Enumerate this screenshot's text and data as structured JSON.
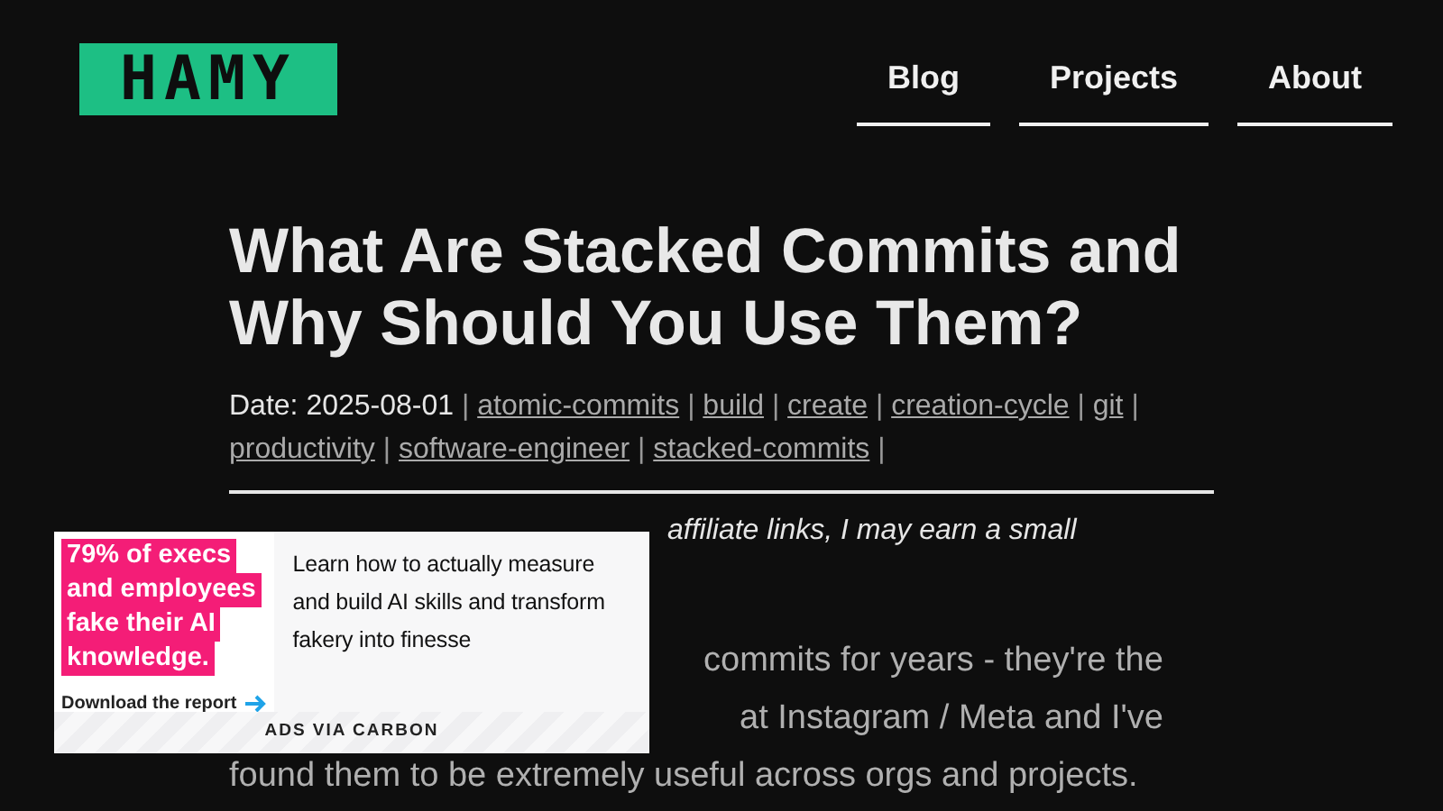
{
  "logo": {
    "text": "HAMY"
  },
  "nav": [
    {
      "label": "Blog"
    },
    {
      "label": "Projects"
    },
    {
      "label": "About"
    }
  ],
  "article": {
    "title": "What Are Stacked Commits and Why Should You Use Them?",
    "date": "Date: 2025-08-01",
    "separator": "|",
    "tags": [
      "atomic-commits",
      "build",
      "create",
      "creation-cycle",
      "git",
      "productivity",
      "software-engineer",
      "stacked-commits"
    ],
    "disclosure_visible": "affiliate links, I may earn a small",
    "paragraph_lines": [
      "commits for years - they're the",
      "at Instagram / Meta and I've",
      "found them to be extremely useful across orgs and projects."
    ]
  },
  "ad": {
    "headline_lines": [
      "79% of execs",
      "and employees",
      "fake their AI",
      "knowledge."
    ],
    "cta": "Download the report",
    "text": "Learn how to actually measure and build AI skills and transform fakery into finesse",
    "footer": "ADS VIA CARBON"
  }
}
